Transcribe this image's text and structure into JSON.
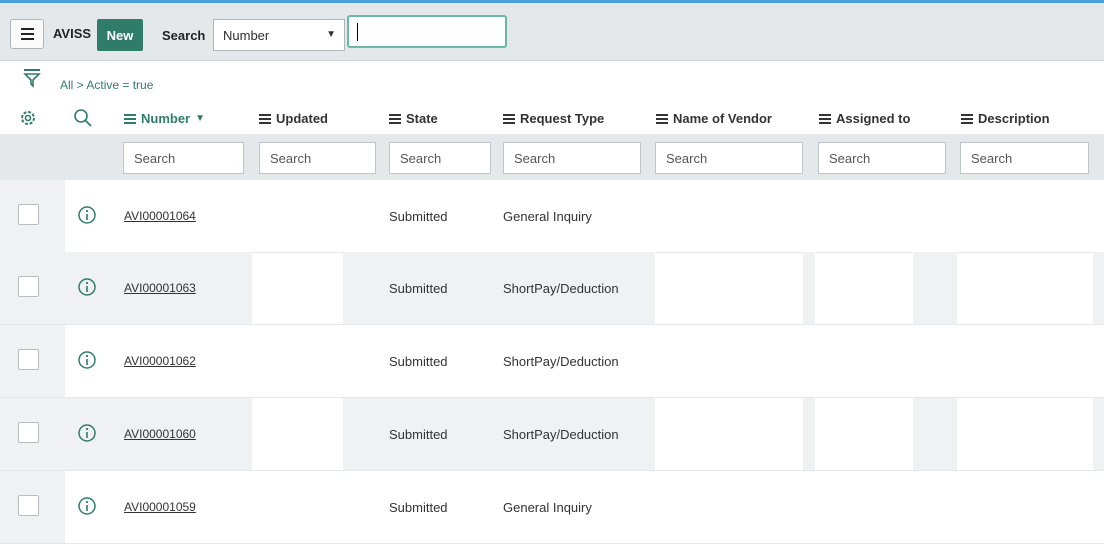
{
  "toolbar": {
    "app_title": "AVISS",
    "new_label": "New",
    "search_label": "Search",
    "field_selected": "Number",
    "search_value": ""
  },
  "breadcrumb": "All > Active = true",
  "columns": [
    {
      "label": "Number",
      "sorted": true,
      "sort_dir": "▼"
    },
    {
      "label": "Updated"
    },
    {
      "label": "State"
    },
    {
      "label": "Request Type"
    },
    {
      "label": "Name of Vendor"
    },
    {
      "label": "Assigned to"
    },
    {
      "label": "Description"
    }
  ],
  "column_search_placeholder": "Search",
  "rows": [
    {
      "number": "AVI00001064",
      "state": "Submitted",
      "request_type": "General Inquiry"
    },
    {
      "number": "AVI00001063",
      "state": "Submitted",
      "request_type": "ShortPay/Deduction"
    },
    {
      "number": "AVI00001062",
      "state": "Submitted",
      "request_type": "ShortPay/Deduction"
    },
    {
      "number": "AVI00001060",
      "state": "Submitted",
      "request_type": "ShortPay/Deduction"
    },
    {
      "number": "AVI00001059",
      "state": "Submitted",
      "request_type": "General Inquiry"
    }
  ],
  "colors": {
    "accent": "#2f7d68",
    "toolbar_bg": "#e5e8eb",
    "top_line": "#4aa3d8"
  }
}
